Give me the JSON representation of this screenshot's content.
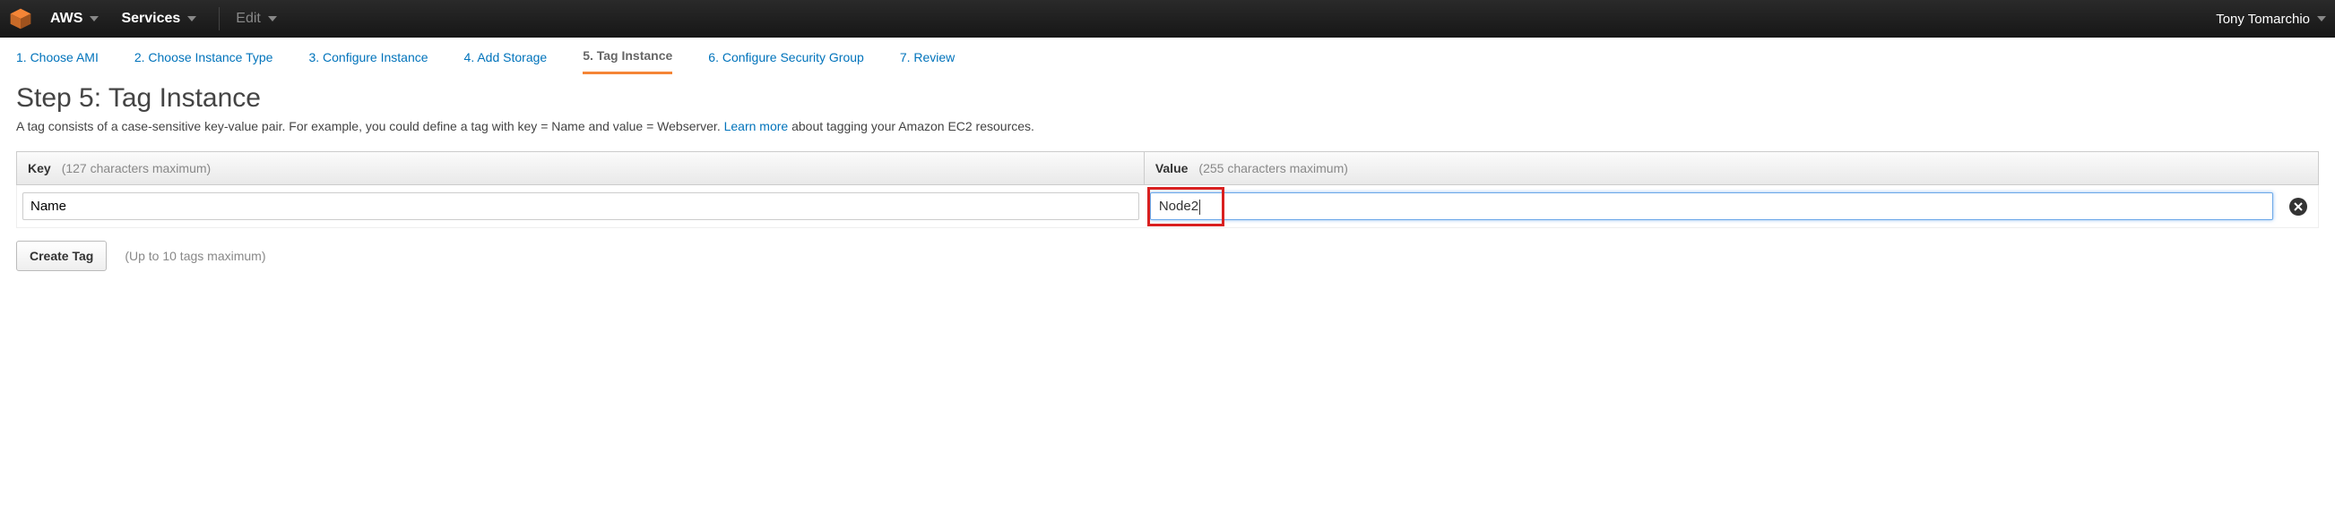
{
  "nav": {
    "brand": "AWS",
    "services": "Services",
    "edit": "Edit",
    "user": "Tony Tomarchio"
  },
  "wizard": {
    "steps": [
      {
        "label": "1. Choose AMI",
        "active": false
      },
      {
        "label": "2. Choose Instance Type",
        "active": false
      },
      {
        "label": "3. Configure Instance",
        "active": false
      },
      {
        "label": "4. Add Storage",
        "active": false
      },
      {
        "label": "5. Tag Instance",
        "active": true
      },
      {
        "label": "6. Configure Security Group",
        "active": false
      },
      {
        "label": "7. Review",
        "active": false
      }
    ]
  },
  "heading": "Step 5: Tag Instance",
  "description": {
    "text_before": "A tag consists of a case-sensitive key-value pair. For example, you could define a tag with key = Name and value = Webserver. ",
    "learn_more": "Learn more",
    "text_after": " about tagging your Amazon EC2 resources."
  },
  "table": {
    "key_header": "Key",
    "key_hint": "(127 characters maximum)",
    "value_header": "Value",
    "value_hint": "(255 characters maximum)",
    "rows": [
      {
        "key": "Name",
        "value": "Node2"
      }
    ]
  },
  "create_tag": {
    "button": "Create Tag",
    "hint": "(Up to 10 tags maximum)"
  }
}
